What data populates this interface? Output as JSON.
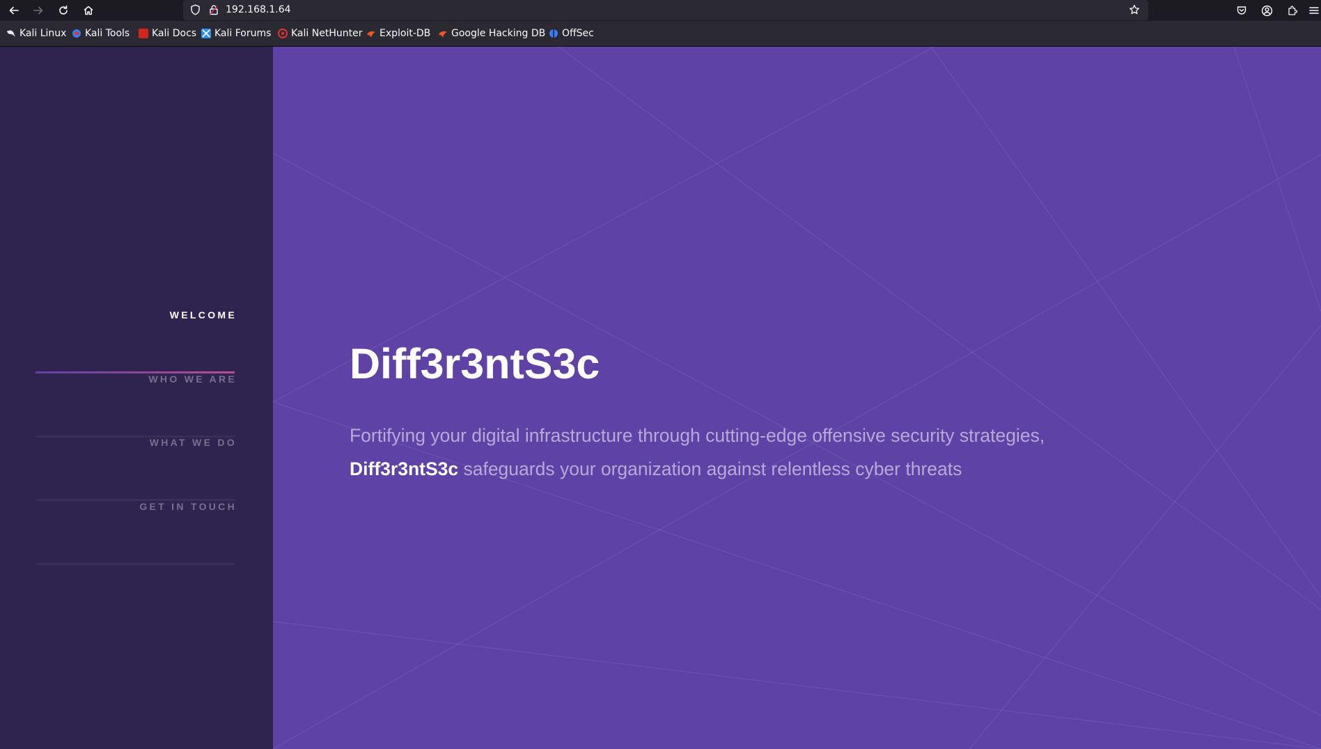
{
  "browser": {
    "url": "192.168.1.64",
    "nav_icons": [
      "back-arrow-icon",
      "forward-arrow-icon",
      "reload-icon",
      "home-icon"
    ],
    "url_icons": [
      "shield-icon",
      "lock-icon"
    ],
    "right_icons": [
      "star-icon",
      "pocket-icon",
      "account-icon",
      "extensions-icon",
      "menu-icon"
    ]
  },
  "bookmarks": [
    {
      "label": "Kali Linux",
      "icon": "kali-dragon-icon",
      "color": "#e8e8e8"
    },
    {
      "label": "Kali Tools",
      "icon": "kali-tools-icon",
      "color": "#367bf0"
    },
    {
      "label": "Kali Docs",
      "icon": "kali-docs-icon",
      "color": "#d0261c"
    },
    {
      "label": "Kali Forums",
      "icon": "kali-forums-icon",
      "color": "#2d8fe8"
    },
    {
      "label": "Kali NetHunter",
      "icon": "nethunter-icon",
      "color": "#e0332f"
    },
    {
      "label": "Exploit-DB",
      "icon": "exploit-db-icon",
      "color": "#ef5b1f"
    },
    {
      "label": "Google Hacking DB",
      "icon": "ghdb-icon",
      "color": "#ef5b1f"
    },
    {
      "label": "OffSec",
      "icon": "offsec-icon",
      "color": "#3d7cf0"
    }
  ],
  "sidebar": {
    "items": [
      {
        "label": "WELCOME",
        "active": true
      },
      {
        "label": "WHO WE ARE",
        "active": false
      },
      {
        "label": "WHAT WE DO",
        "active": false
      },
      {
        "label": "GET IN TOUCH",
        "active": false
      }
    ]
  },
  "hero": {
    "title": "Diff3r3ntS3c",
    "text_line1": "Fortifying your digital infrastructure through cutting-edge offensive security strategies,",
    "brand": "Diff3r3ntS3c",
    "text_line2": " safeguards your organization against relentless cyber threats"
  },
  "colors": {
    "sidebar_bg": "#2f2350",
    "hero_bg": "#5e42a6",
    "accent_start": "#5e42a6",
    "accent_end": "#b74e91"
  }
}
